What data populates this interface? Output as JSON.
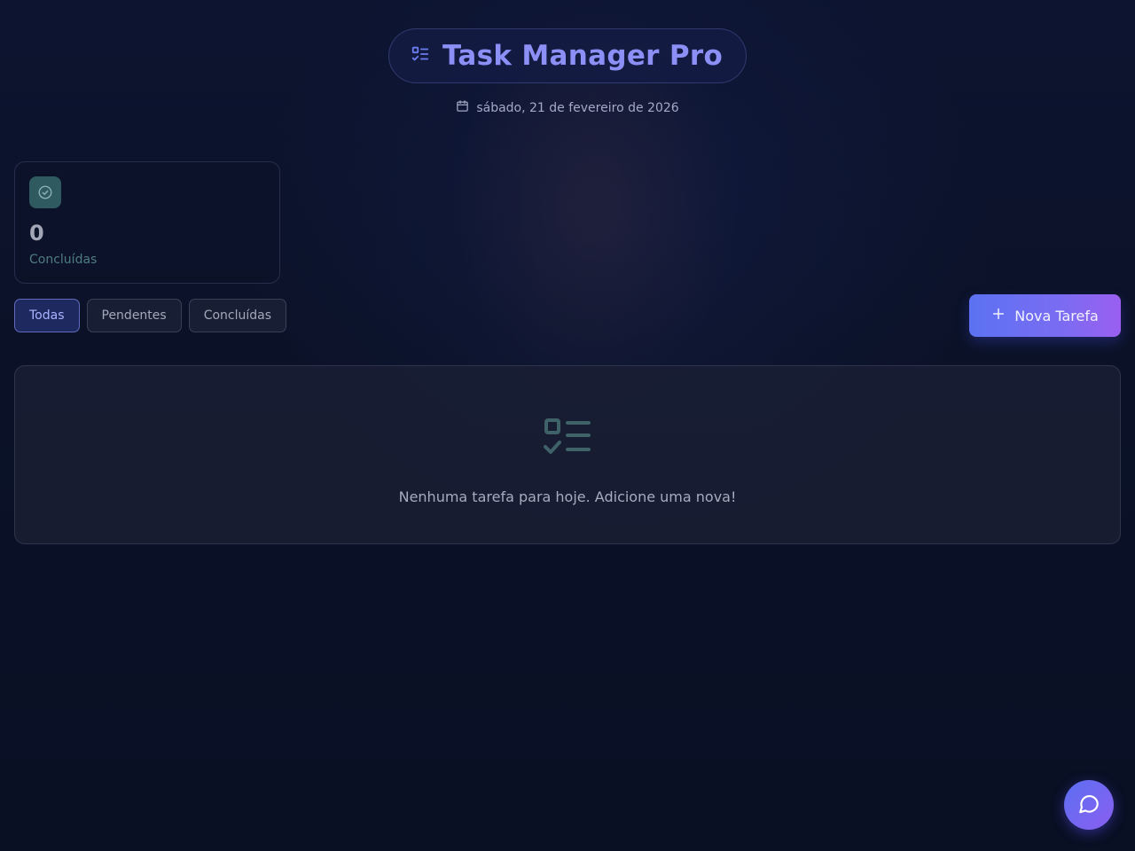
{
  "header": {
    "title": "Task Manager Pro",
    "title_icon": "list-check-icon",
    "date": "sábado, 21 de fevereiro de 2026",
    "date_icon": "calendar-icon"
  },
  "stats": {
    "completed": {
      "icon": "check-circle-icon",
      "value": "0",
      "label": "Concluídas"
    }
  },
  "filters": {
    "items": [
      {
        "label": "Todas",
        "active": true
      },
      {
        "label": "Pendentes",
        "active": false
      },
      {
        "label": "Concluídas",
        "active": false
      }
    ]
  },
  "actions": {
    "new_task_label": "Nova Tarefa",
    "new_task_icon": "plus-icon"
  },
  "empty_state": {
    "icon": "task-list-icon",
    "message": "Nenhuma tarefa para hoje. Adicione uma nova!"
  },
  "chat": {
    "icon": "chat-bubble-icon"
  },
  "colors": {
    "accent": "#6c7cf3",
    "title": "#8c8ff5",
    "success": "#4f7c82",
    "background": "#0b1122"
  }
}
